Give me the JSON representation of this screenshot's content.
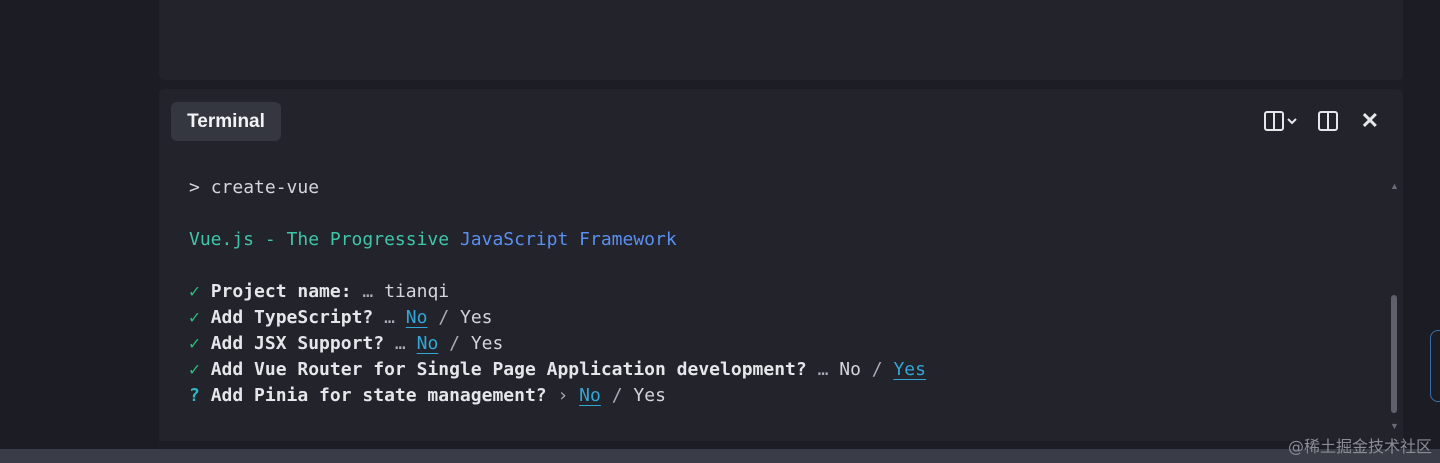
{
  "terminal": {
    "tab_label": "Terminal",
    "actions": {
      "split_menu_icon": "split-dropdown-icon",
      "split_icon": "split-panel-icon",
      "close_glyph": "✕"
    },
    "command": {
      "prompt": ">",
      "text": "create-vue"
    },
    "banner": {
      "part1": "Vue.js - The Progressive",
      "part2": "JavaScript",
      "part3": "Framework"
    },
    "answers": [
      {
        "mark": "✓",
        "question": "Project name:",
        "sep": "…",
        "value": "tianqi"
      },
      {
        "mark": "✓",
        "question": "Add TypeScript?",
        "sep": "…",
        "opt_no": "No",
        "slash": "/",
        "opt_yes": "Yes"
      },
      {
        "mark": "✓",
        "question": "Add JSX Support?",
        "sep": "…",
        "opt_no": "No",
        "slash": "/",
        "opt_yes": "Yes"
      },
      {
        "mark": "✓",
        "question": "Add Vue Router for Single Page Application development?",
        "sep": "…",
        "opt_no": "No",
        "slash": "/",
        "opt_yes": "Yes"
      },
      {
        "mark": "?",
        "question": "Add Pinia for state management?",
        "sep": "›",
        "opt_no": "No",
        "slash": "/",
        "opt_yes": "Yes"
      }
    ]
  },
  "watermark": "@稀土掘金技术社区",
  "colors": {
    "success": "#28c07a",
    "link": "#33a6d6",
    "banner_green": "#3fc5a8",
    "banner_blue": "#5a8ff0"
  }
}
